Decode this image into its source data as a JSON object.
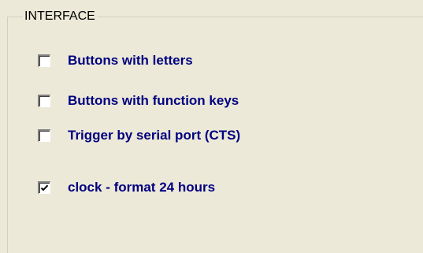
{
  "interface_group": {
    "title": "INTERFACE",
    "options": [
      {
        "label": "Buttons with letters",
        "checked": false
      },
      {
        "label": "Buttons with function keys",
        "checked": false
      },
      {
        "label": "Trigger by serial port (CTS)",
        "checked": false
      },
      {
        "label": "clock - format 24 hours",
        "checked": true
      }
    ]
  },
  "colors": {
    "background": "#ece9d8",
    "label_text": "#000080",
    "group_line": "#d0d0bf"
  }
}
